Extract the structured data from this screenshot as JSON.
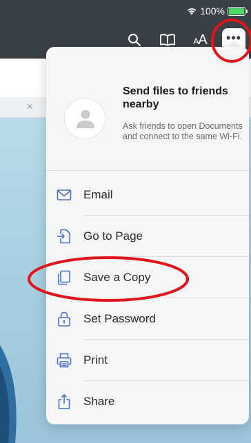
{
  "status_bar": {
    "battery_text": "100%"
  },
  "nav_bar": {
    "font_button_label_small": "A",
    "font_button_label_large": "A",
    "more_button_label": "•••"
  },
  "document": {
    "tab_close_label": "×"
  },
  "menu": {
    "share_nearby": {
      "title": "Send files to friends nearby",
      "description": "Ask friends to open Documents and connect to the same Wi-Fi."
    },
    "items": [
      {
        "label": "Email",
        "icon": "envelope-icon"
      },
      {
        "label": "Go to Page",
        "icon": "go-to-page-icon"
      },
      {
        "label": "Save a Copy",
        "icon": "copy-icon"
      },
      {
        "label": "Set Password",
        "icon": "lock-icon"
      },
      {
        "label": "Print",
        "icon": "printer-icon"
      },
      {
        "label": "Share",
        "icon": "share-icon"
      }
    ]
  },
  "colors": {
    "toolbar": "#3b4046",
    "accent": "#4a6fd1",
    "annotation": "#e1141b",
    "battery": "#4cd964"
  }
}
